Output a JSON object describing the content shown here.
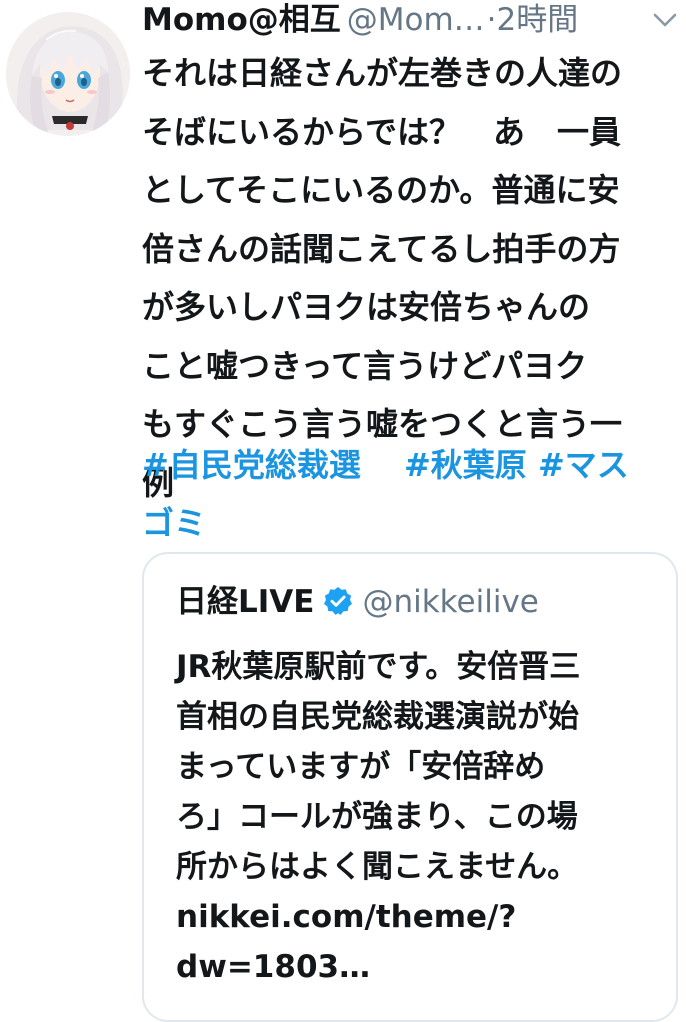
{
  "tweet": {
    "author_name": "Momo@相互",
    "author_handle": "@Mom…",
    "separator": "·",
    "timestamp": "2時間",
    "text_lines": [
      "それは日経さんが左巻きの人達の",
      "そばにいるからでは？　あ　一員",
      "としてそこにいるのか。普通に安",
      "倍さんの話聞こえてるし拍手の方",
      "が多いしパヨクは安倍ちゃんの",
      "こと嘘つきって言うけどパヨク",
      "もすぐこう言う嘘をつくと言う一",
      "例"
    ],
    "hashtags": [
      "#自民党総裁選",
      "#秋葉原",
      "#マスゴミ"
    ]
  },
  "quoted_tweet": {
    "author_name": "日経LIVE",
    "author_handle": "@nikkeilive",
    "verified": true,
    "text_lines": [
      "JR秋葉原駅前です。安倍晋三",
      "首相の自民党総裁選演説が始",
      "まっていますが「安倍辞め",
      "ろ」コールが強まり、この場",
      "所からはよく聞こえません。",
      "nikkei.com/theme/?",
      "dw=1803…"
    ]
  },
  "icons": {
    "avatar": "anime-girl-avatar",
    "menu": "chevron-down-icon",
    "verified": "verified-badge-icon"
  },
  "colors": {
    "text": "#14171a",
    "secondary": "#657786",
    "link": "#1b95e0",
    "border": "#e1e8ed",
    "verified": "#1da1f2"
  }
}
